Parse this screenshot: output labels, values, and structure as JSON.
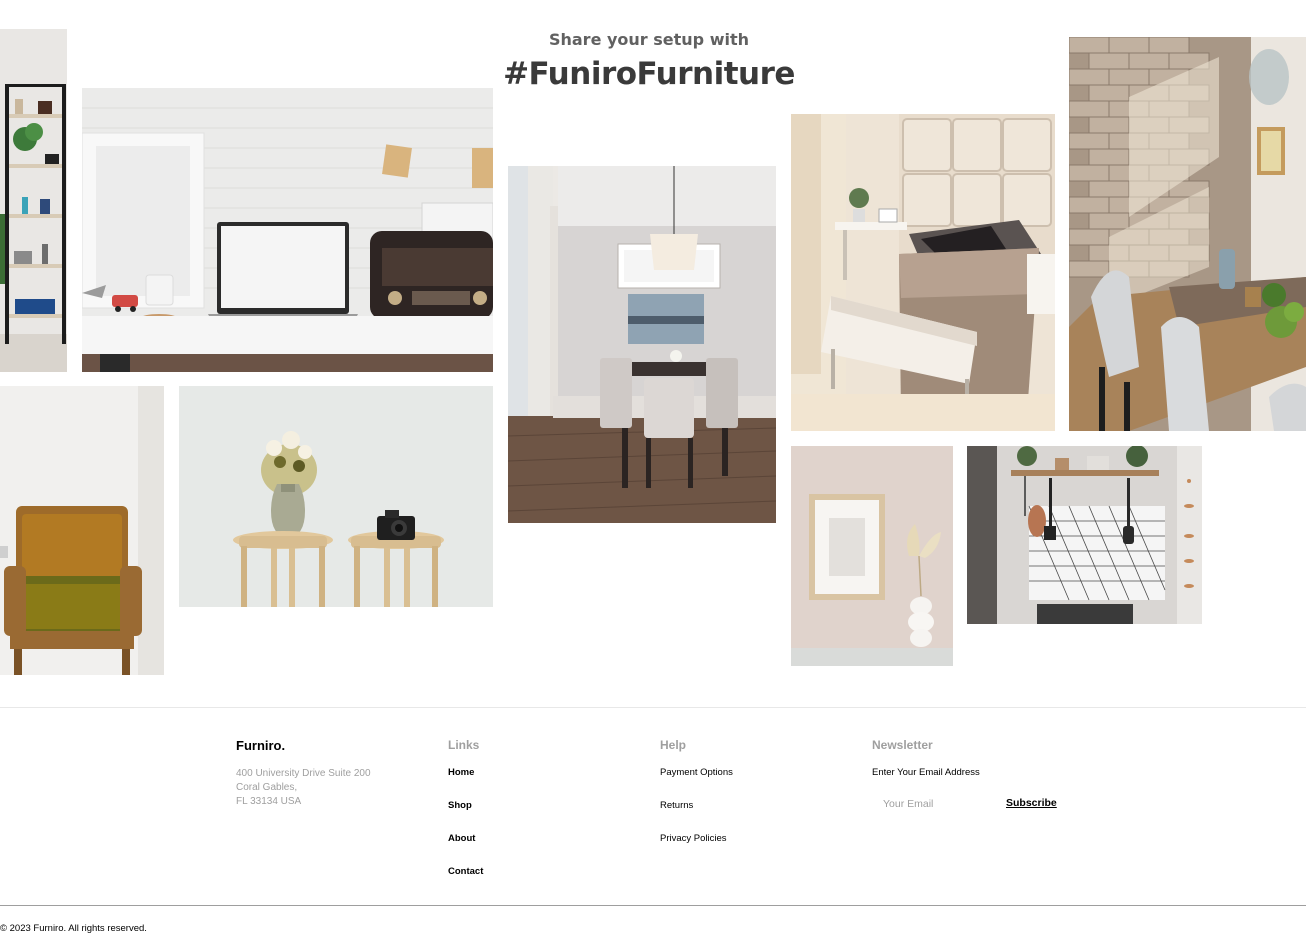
{
  "gallery": {
    "subtitle": "Share your setup with",
    "title": "#FuniroFurniture",
    "photos": [
      {
        "name": "photo-shelf",
        "icon": "bookshelf-photo"
      },
      {
        "name": "photo-laptop-desk",
        "icon": "laptop-desk-photo"
      },
      {
        "name": "photo-armchair",
        "icon": "armchair-photo"
      },
      {
        "name": "photo-stools-vase",
        "icon": "stools-photo"
      },
      {
        "name": "photo-dining-room",
        "icon": "dining-room-photo"
      },
      {
        "name": "photo-bedroom",
        "icon": "bedroom-photo"
      },
      {
        "name": "photo-wall-frame-vase",
        "icon": "frame-vase-photo"
      },
      {
        "name": "photo-kitchen-shelf",
        "icon": "kitchen-photo"
      },
      {
        "name": "photo-dining-table-brick",
        "icon": "brick-dining-photo"
      }
    ]
  },
  "footer": {
    "brand": "Furniro.",
    "address": [
      "400 University Drive Suite 200",
      "Coral Gables,",
      "FL 33134 USA"
    ],
    "links_title": "Links",
    "links": [
      "Home",
      "Shop",
      "About",
      "Contact"
    ],
    "help_title": "Help",
    "help": [
      "Payment Options",
      "Returns",
      "Privacy Policies"
    ],
    "newsletter_title": "Newsletter",
    "newsletter_label": "Enter Your Email Address",
    "email_placeholder": "Your Email",
    "subscribe_label": "Subscribe",
    "copyright": "© 2023 Furniro. All rights reserved."
  },
  "colors": {
    "heading": "#3A3A3A",
    "subheading": "#616161",
    "muted_text": "#9F9F9F",
    "divider": "#E8E8E8"
  }
}
